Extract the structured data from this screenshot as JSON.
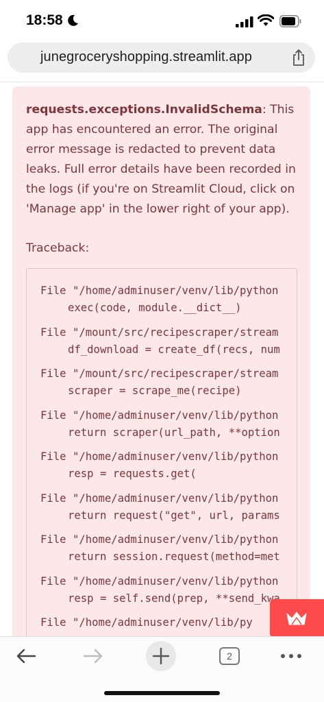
{
  "status_bar": {
    "time": "18:58",
    "icons": [
      "moon-icon",
      "cellular-signal-icon",
      "wifi-icon",
      "battery-icon"
    ]
  },
  "browser": {
    "url": "junegroceryshopping.streamlit.app",
    "share_icon": "share-icon"
  },
  "error": {
    "exception": "requests.exceptions.InvalidSchema",
    "message": ": This app has encountered an error. The original error message is redacted to prevent data leaks. Full error details have been recorded in the logs (if you're on Streamlit Cloud, click on 'Manage app' in the lower right of your app).",
    "traceback_label": "Traceback:",
    "traceback": [
      {
        "file": "File \"/home/adminuser/venv/lib/python",
        "code": "exec(code, module.__dict__)"
      },
      {
        "file": "File \"/mount/src/recipescraper/stream",
        "code": "df_download = create_df(recs, num"
      },
      {
        "file": "File \"/mount/src/recipescraper/stream",
        "code": "scraper = scrape_me(recipe)"
      },
      {
        "file": "File \"/home/adminuser/venv/lib/python",
        "code": "return scraper(url_path, **option"
      },
      {
        "file": "File \"/home/adminuser/venv/lib/python",
        "code": "resp = requests.get("
      },
      {
        "file": "File \"/home/adminuser/venv/lib/python",
        "code": "return request(\"get\", url, params"
      },
      {
        "file": "File \"/home/adminuser/venv/lib/python",
        "code": "return session.request(method=met"
      },
      {
        "file": "File \"/home/adminuser/venv/lib/python",
        "code": "resp = self.send(prep, **send_kwa"
      },
      {
        "file": "File \"/home/adminuser/venv/lib/py",
        "code": ""
      }
    ]
  },
  "colors": {
    "error_background": "#fde8e9",
    "error_text": "#7d353b",
    "streamlit_red": "#ff4b4b"
  },
  "toolbar": {
    "back_icon": "arrow-left-icon",
    "forward_icon": "arrow-right-icon",
    "new_tab_icon": "plus-icon",
    "tab_count": "2",
    "more_icon": "ellipsis-icon"
  }
}
